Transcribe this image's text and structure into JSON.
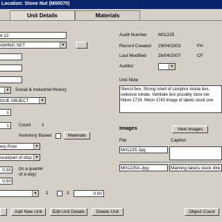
{
  "window": {
    "title": "Location: Stone Nut  (M00070)"
  },
  "tabs": [
    {
      "label": "Unit Details"
    },
    {
      "label": "Materials"
    }
  ],
  "left": {
    "field1": "e 12",
    "field2": "AWING SET",
    "class_label": "Social & Industrial History",
    "object_type": "GUE OBJECT",
    "num1": "1",
    "num2": "1",
    "count_label": "Count",
    "count_value": "1",
    "inventory_label": "Inventory Based",
    "materials_button": "Materials",
    "condition": "ery Poor",
    "disposal": "ocal/part of disp",
    "val1": "0.50",
    "val2": "0.50",
    "note_text": "(to a quarter of a day)",
    "num_2": "2",
    "num_3": "3",
    "total": "0.00"
  },
  "right": {
    "audit_number_label": "Audit Number",
    "audit_number": "M01225",
    "record_created_label": "Record Created",
    "record_created": "29/04/2003",
    "record_created_by": "FH",
    "last_modified_label": "Last Modified",
    "last_modified": "26/04/2007",
    "last_modified_by": "CF",
    "auditor_label": "Auditor",
    "unit_note_label": "Unit Note",
    "unit_note": "Stencil box. Strong smell of camphor inside box, cellulose nitrate. Ventilate box possibly store ste Nikon 1719. Nikon 1743 image of labels stuck one",
    "images_label": "Images",
    "view_images_button": "View Images",
    "file_label": "File",
    "caption_label": "Caption",
    "file1": "M01225.Jpg",
    "caption1": "",
    "file2": "M01225A.Jpg",
    "caption2": "Marking labels stuck dire"
  },
  "footer": {
    "add_new_unit": "Add New Unit",
    "edit_unit_details": "Edit Unit Details",
    "delete_unit": "Delete Unit",
    "object_count": "Object Count"
  }
}
